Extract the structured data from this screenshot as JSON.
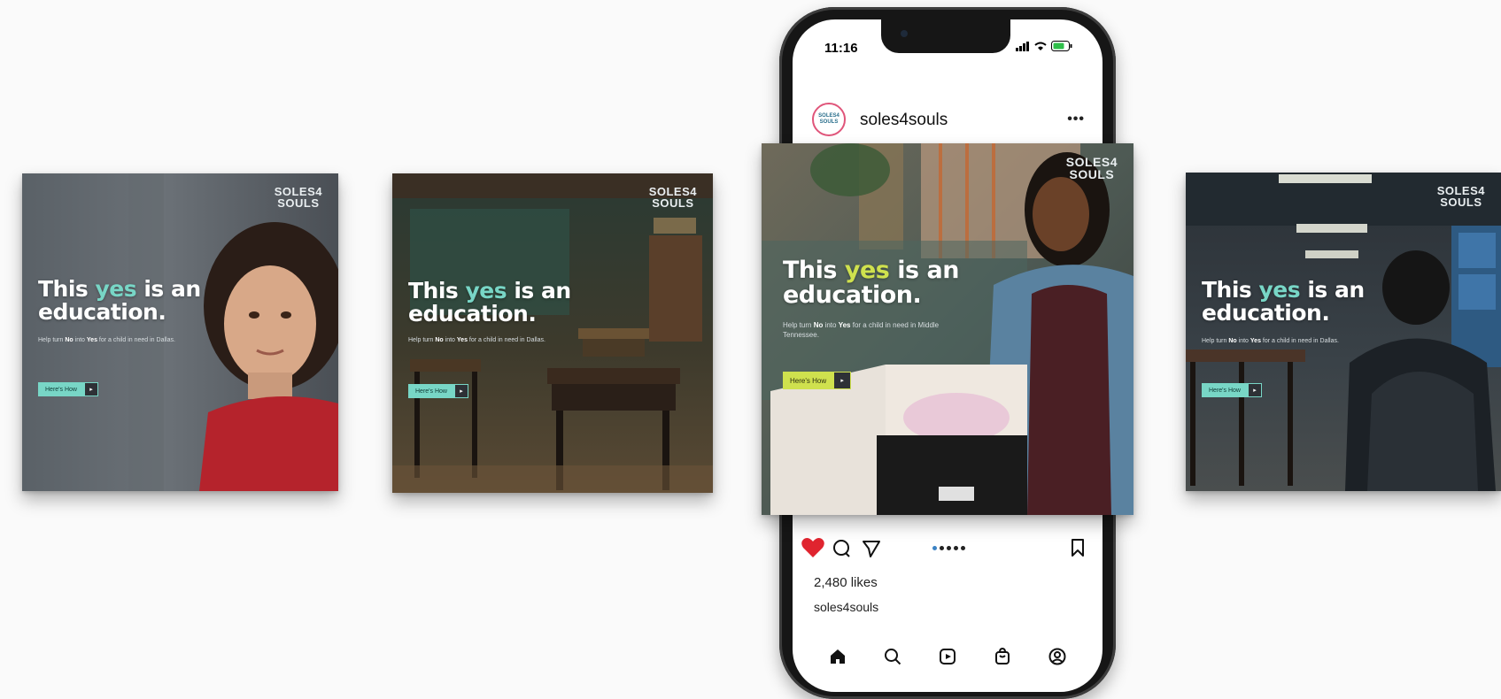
{
  "brand": {
    "logo_line1": "SOLES4",
    "logo_line2": "SOULS",
    "accent_teal": "#78d6c6",
    "accent_lime": "#cfe14e"
  },
  "cards": [
    {
      "headline_pre": "This ",
      "headline_hl": "yes",
      "headline_post": " is an",
      "headline_line2": "education.",
      "copy_pre": "Help turn ",
      "copy_no": "No",
      "copy_mid": " into ",
      "copy_yes": "Yes",
      "copy_post": " for a child in need in Dallas.",
      "cta": "Here's How",
      "cta_icon": "arrow-icon"
    },
    {
      "headline_pre": "This ",
      "headline_hl": "yes",
      "headline_post": " is an",
      "headline_line2": "education.",
      "copy_pre": "Help turn ",
      "copy_no": "No",
      "copy_mid": " into ",
      "copy_yes": "Yes",
      "copy_post": " for a child in need in Dallas.",
      "cta": "Here's How",
      "cta_icon": "arrow-icon"
    },
    {
      "headline_pre": "This ",
      "headline_hl": "yes",
      "headline_post": " is an",
      "headline_line2": "education.",
      "copy_pre": "Help turn ",
      "copy_no": "No",
      "copy_mid": " into ",
      "copy_yes": "Yes",
      "copy_post": " for a child in need in Dallas.",
      "cta": "Here's How",
      "cta_icon": "arrow-icon"
    }
  ],
  "featured": {
    "headline_pre": "This ",
    "headline_hl": "yes",
    "headline_post": " is an",
    "headline_line2": "education.",
    "copy_pre": "Help turn ",
    "copy_no": "No",
    "copy_mid": " into ",
    "copy_yes": "Yes",
    "copy_post": " for a child in need in Middle Tennessee.",
    "cta": "Here's How",
    "cta_icon": "arrow-icon"
  },
  "phone": {
    "time": "11:16",
    "avatar_line1": "SOLES4",
    "avatar_line2": "SOULS",
    "username": "soles4souls",
    "more": "•••",
    "likes": "2,480 likes",
    "caption": "soles4souls",
    "status_icons": [
      "signal-icon",
      "wifi-icon",
      "battery-icon"
    ],
    "action_icons": [
      "heart-icon",
      "comment-icon",
      "share-icon",
      "bookmark-icon"
    ],
    "tab_icons": [
      "home-icon",
      "search-icon",
      "reels-icon",
      "shop-icon",
      "profile-icon"
    ]
  }
}
